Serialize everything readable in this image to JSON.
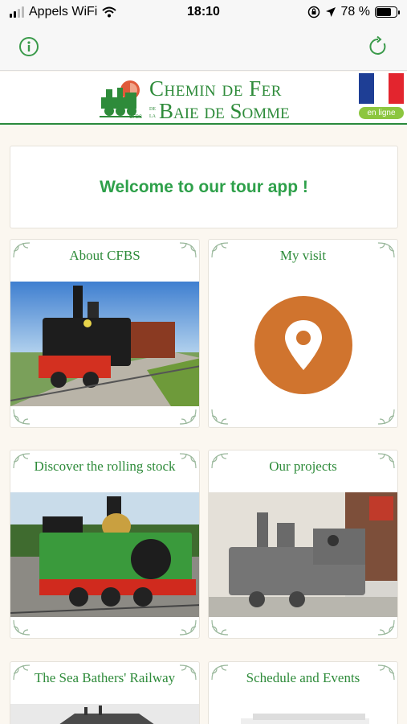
{
  "status_bar": {
    "carrier": "Appels WiFi",
    "time": "18:10",
    "battery_text": "78 %",
    "battery_level": 0.78
  },
  "toolbar": {
    "info_icon": "info-icon",
    "refresh_icon": "refresh-icon"
  },
  "brand": {
    "line1": "Chemin de Fer",
    "de": "de",
    "la": "la",
    "line2": "Baie de Somme",
    "logo_badge": "CFBS",
    "lang_badge": "en ligne",
    "flag_colors": [
      "#1e3e95",
      "#ffffff",
      "#e3252e"
    ]
  },
  "welcome": {
    "text": "Welcome to our tour app !"
  },
  "tiles": [
    {
      "title": "About CFBS"
    },
    {
      "title": "My visit",
      "icon": "map-pin-icon"
    },
    {
      "title": "Discover the rolling stock"
    },
    {
      "title": "Our projects"
    },
    {
      "title": "The Sea Bathers' Railway"
    },
    {
      "title": "Schedule and Events"
    }
  ],
  "colors": {
    "brand_green": "#2e8b3a",
    "welcome_green": "#2ea04a",
    "pin_orange": "#d0742e",
    "badge_green": "#8cc63f"
  }
}
